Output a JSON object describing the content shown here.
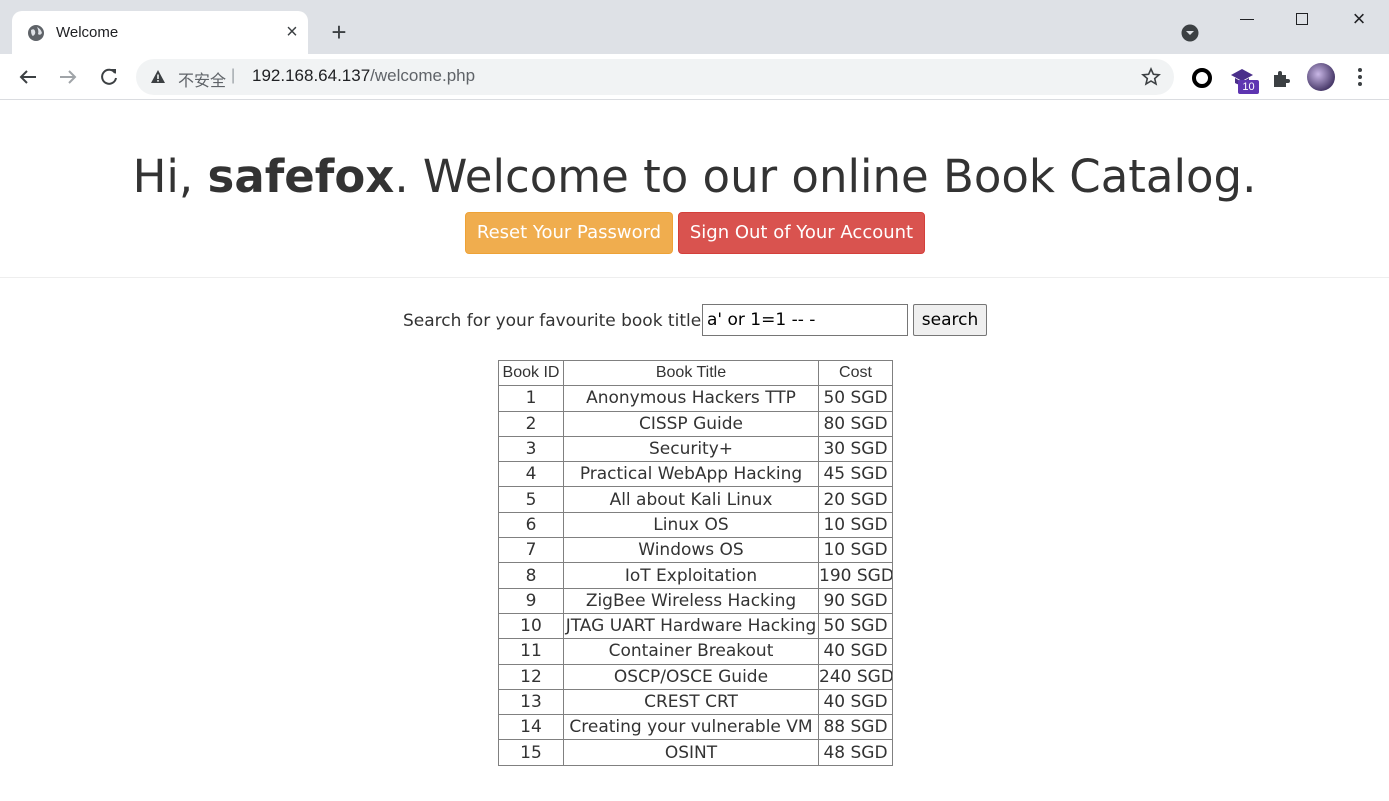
{
  "browser": {
    "tab_title": "Welcome",
    "security_label": "不安全",
    "separator": "|",
    "url_host": "192.168.64.137",
    "url_path": "/welcome.php",
    "extension_badge": "10"
  },
  "header": {
    "greeting_prefix": "Hi, ",
    "username": "safefox",
    "greeting_suffix": ". Welcome to our online Book Catalog.",
    "reset_label": "Reset Your Password",
    "signout_label": "Sign Out of Your Account"
  },
  "search": {
    "label": "Search for your favourite book title",
    "value": "a' or 1=1 -- -",
    "button_label": "search"
  },
  "table": {
    "columns": [
      "Book ID",
      "Book Title",
      "Cost"
    ],
    "rows": [
      [
        "1",
        "Anonymous Hackers TTP",
        "50 SGD"
      ],
      [
        "2",
        "CISSP Guide",
        "80 SGD"
      ],
      [
        "3",
        "Security+",
        "30 SGD"
      ],
      [
        "4",
        "Practical WebApp Hacking",
        "45 SGD"
      ],
      [
        "5",
        "All about Kali Linux",
        "20 SGD"
      ],
      [
        "6",
        "Linux OS",
        "10 SGD"
      ],
      [
        "7",
        "Windows OS",
        "10 SGD"
      ],
      [
        "8",
        "IoT Exploitation",
        "190 SGD"
      ],
      [
        "9",
        "ZigBee Wireless Hacking",
        "90 SGD"
      ],
      [
        "10",
        "JTAG UART Hardware Hacking",
        "50 SGD"
      ],
      [
        "11",
        "Container Breakout",
        "40 SGD"
      ],
      [
        "12",
        "OSCP/OSCE Guide",
        "240 SGD"
      ],
      [
        "13",
        "CREST CRT",
        "40 SGD"
      ],
      [
        "14",
        "Creating your vulnerable VM",
        "88 SGD"
      ],
      [
        "15",
        "OSINT",
        "48 SGD"
      ]
    ]
  },
  "colors": {
    "warning": "#f0ad4e",
    "danger": "#d9534f",
    "extension_badge": "#5e35b1"
  }
}
